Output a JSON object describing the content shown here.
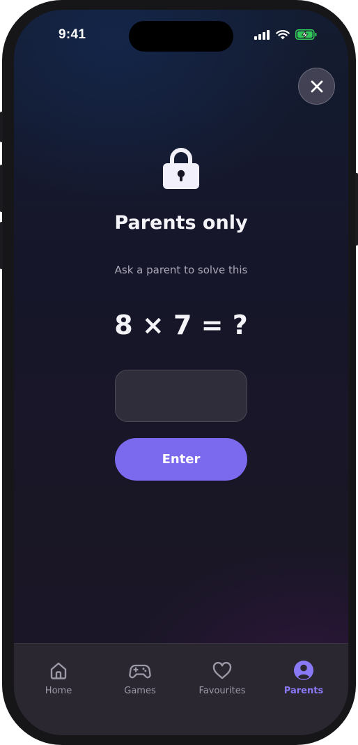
{
  "status_bar": {
    "time": "9:41"
  },
  "parental_gate": {
    "title": "Parents only",
    "subtitle": "Ask a parent to solve this",
    "question": "8 × 7 = ?",
    "answer_value": "",
    "enter_label": "Enter",
    "close_icon": "close-icon",
    "lock_icon": "lock-icon"
  },
  "tab_bar": {
    "tabs": [
      {
        "label": "Home",
        "icon": "home-icon",
        "active": false
      },
      {
        "label": "Games",
        "icon": "gamepad-icon",
        "active": false
      },
      {
        "label": "Favourites",
        "icon": "heart-icon",
        "active": false
      },
      {
        "label": "Parents",
        "icon": "user-circle-icon",
        "active": true
      }
    ]
  },
  "colors": {
    "accent": "#7b6aee",
    "active_tab": "#8a79f4",
    "inactive_tab": "#9d9aa8",
    "battery_green": "#34c759"
  }
}
